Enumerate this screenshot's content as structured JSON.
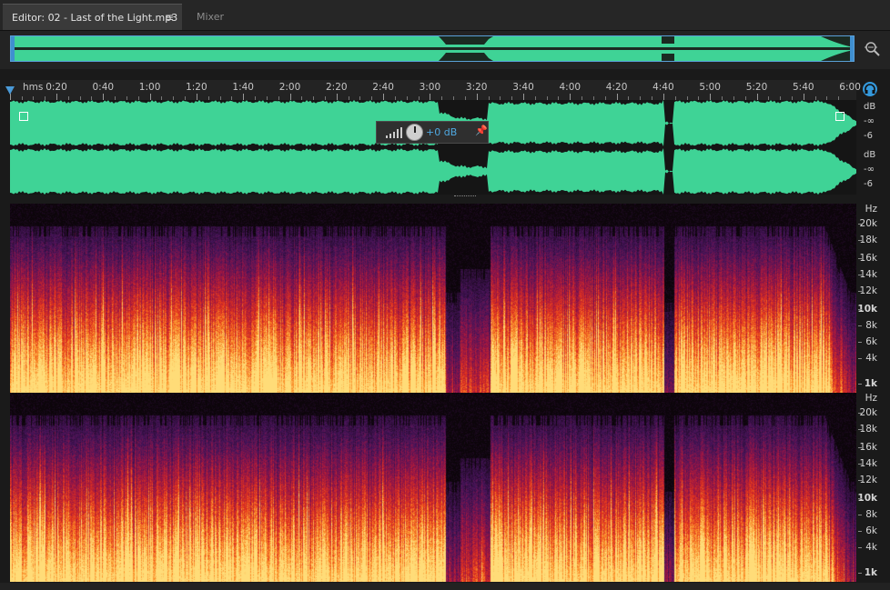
{
  "tabs": {
    "editor_label": "Editor: 02 - Last of the Light.mp3",
    "menu_glyph": "≡",
    "mixer_label": "Mixer"
  },
  "timeline": {
    "unit": "hms",
    "labels": [
      "0:20",
      "0:40",
      "1:00",
      "1:20",
      "1:40",
      "2:00",
      "2:20",
      "2:40",
      "3:00",
      "3:20",
      "3:40",
      "4:00",
      "4:20",
      "4:40",
      "5:00",
      "5:20",
      "5:40",
      "6:00"
    ]
  },
  "hud": {
    "volume": "+0 dB"
  },
  "waveform": {
    "color": "#3fd396",
    "db_ruler_ch1": [
      "dB",
      "-∞",
      "-6"
    ],
    "db_ruler_ch2": [
      "dB",
      "-∞",
      "-6"
    ]
  },
  "spectral": {
    "hz_labels": [
      "Hz",
      "20k",
      "18k",
      "16k",
      "14k",
      "12k",
      "10k",
      "8k",
      "6k",
      "4k",
      "1k"
    ]
  },
  "colors": {
    "accent": "#3fa0e0",
    "wave": "#3fd396"
  },
  "icons": [
    "zoom-icon",
    "headphones-icon",
    "fade-in-icon",
    "fade-out-icon",
    "pin-icon",
    "level-bars-icon"
  ]
}
